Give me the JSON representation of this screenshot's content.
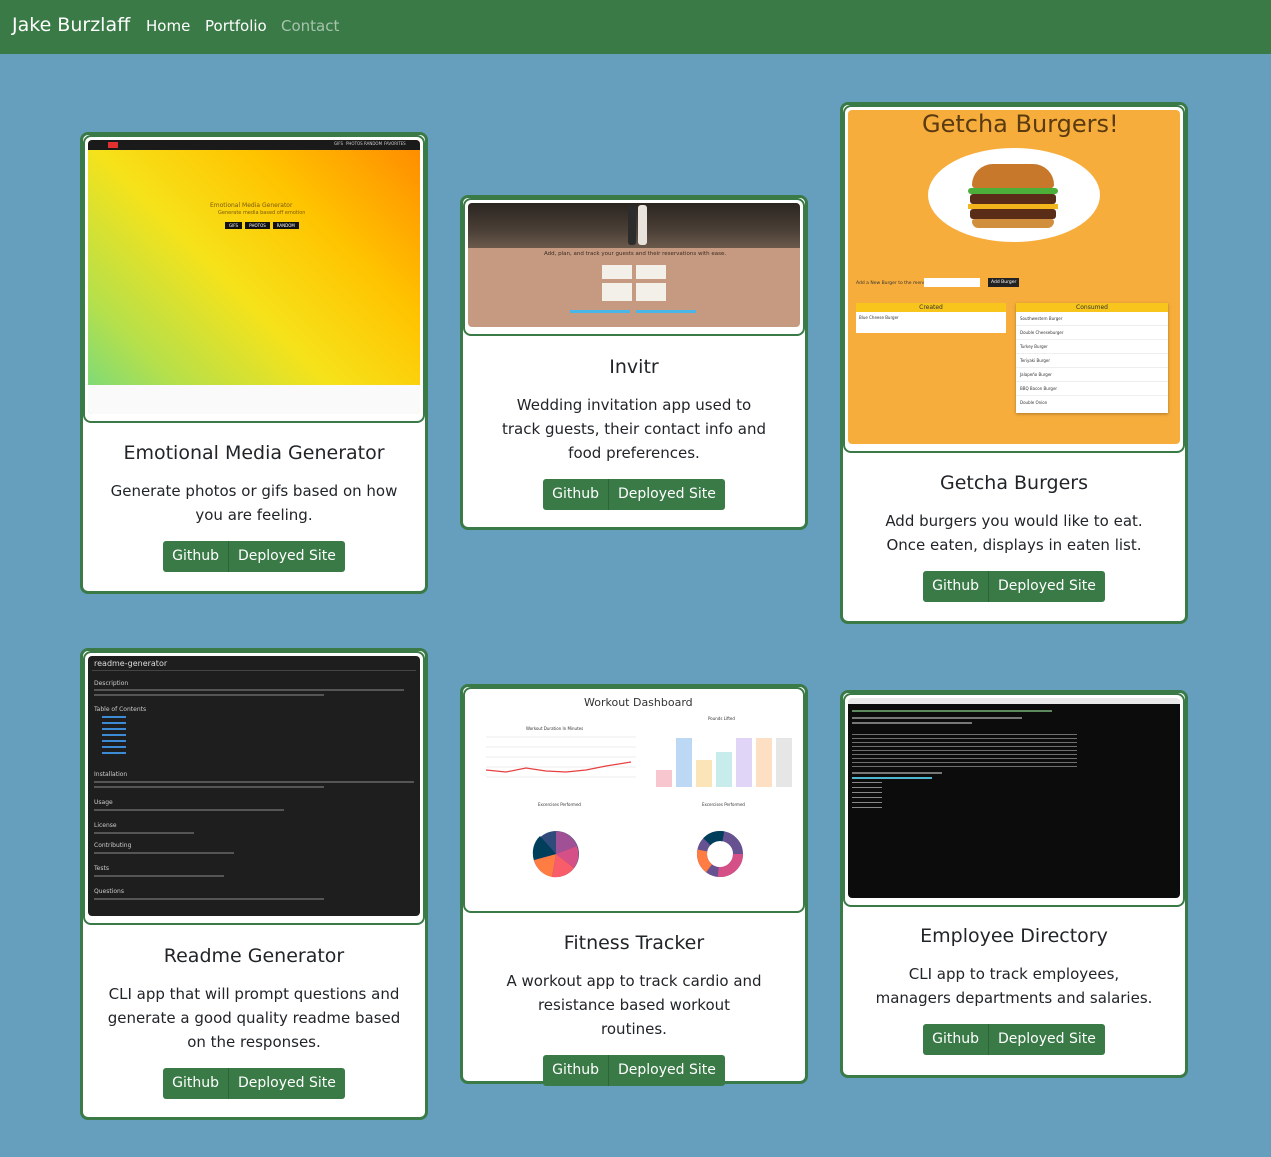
{
  "navbar": {
    "brand": "Jake Burzlaff",
    "links": [
      "Home",
      "Portfolio",
      "Contact"
    ]
  },
  "projects": [
    {
      "title": "Emotional Media Generator",
      "description": "Generate photos or gifs based on how you are feeling.",
      "github_label": "Github",
      "deployed_label": "Deployed Site",
      "preview_heading": "Emotional Media Generator",
      "preview_sub": "Generate media based off emotion",
      "preview_buttons": [
        "GIFS",
        "PHOTOS",
        "RANDOM"
      ],
      "preview_nav": [
        "GIFS",
        "PHOTOS",
        "RANDOM",
        "FAVORITES"
      ]
    },
    {
      "title": "Invitr",
      "description": "Wedding invitation app used to track guests, their contact info and food preferences.",
      "github_label": "Github",
      "deployed_label": "Deployed Site",
      "preview_heading": "Add, plan, and track your guests and their reservations with ease."
    },
    {
      "title": "Getcha Burgers",
      "description": "Add burgers you would like to eat. Once eaten, displays in eaten list.",
      "github_label": "Github",
      "deployed_label": "Deployed Site",
      "preview_heading": "Getcha Burgers!",
      "preview_add_label": "Add a New Burger to the menu:",
      "preview_add_button": "Add Burger",
      "preview_created": "Created",
      "preview_consumed": "Consumed",
      "preview_created_items": [
        "Blue Cheese Burger"
      ],
      "preview_consumed_items": [
        "Southwestern Burger",
        "Double Cheeseburger",
        "Turkey Burger",
        "Teriyaki Burger",
        "Jalapeño Burger",
        "BBQ Bacon Burger",
        "Double Onion"
      ]
    },
    {
      "title": "Readme Generator",
      "description": "CLI app that will prompt questions and generate a good quality readme based on the responses.",
      "github_label": "Github",
      "deployed_label": "Deployed Site",
      "preview_heading": "readme-generator",
      "preview_sections": [
        "Description",
        "Table of Contents",
        "Installation",
        "Usage",
        "License",
        "Contributing",
        "Tests",
        "Questions"
      ]
    },
    {
      "title": "Fitness Tracker",
      "description": "A workout app to track cardio and resistance based workout routines.",
      "github_label": "Github",
      "deployed_label": "Deployed Site",
      "preview_heading": "Workout Dashboard",
      "preview_chart1": "Workout Duration In Minutes",
      "preview_chart2": "Pounds Lifted",
      "preview_chart3": "Excercises Performed",
      "preview_chart4": "Excercises Performed"
    },
    {
      "title": "Employee Directory",
      "description": "CLI app to track employees, managers departments and salaries.",
      "github_label": "Github",
      "deployed_label": "Deployed Site"
    }
  ]
}
